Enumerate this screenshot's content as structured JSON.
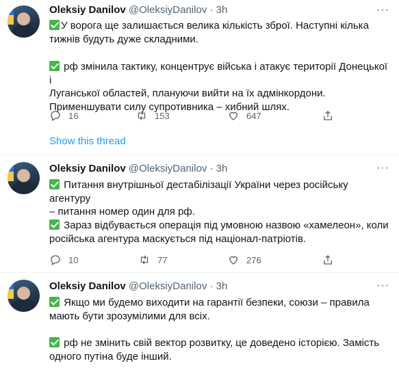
{
  "tweets": [
    {
      "author": "Oleksiy Danilov",
      "handle": "@OleksiyDanilov",
      "dot": "·",
      "time": "3h",
      "more": "···",
      "p1_lines": [
        "У ворога ще залишається велика кількість зброї. Наступні кілька",
        "тижнів будуть дуже складними."
      ],
      "p2_lines": [
        "рф змінила тактику, концентрує війська і атакує території Донецької і",
        "Луганської областей, плануючи вийти на їх адмінкордони.",
        "Применшувати силу супротивника – хибний шлях."
      ],
      "replies": "16",
      "retweets": "153",
      "likes": "647"
    },
    {
      "author": "Oleksiy Danilov",
      "handle": "@OleksiyDanilov",
      "dot": "·",
      "time": "3h",
      "more": "···",
      "p1_lines": [
        "Питання внутрішньої дестабілізації України через російську агентуру",
        "– питання номер один для рф."
      ],
      "p2_lines": [
        "Зараз відбувається операція під умовною назвою «хамелеон», коли",
        "російська агентура маскується під націонал-патріотів."
      ],
      "replies": "10",
      "retweets": "77",
      "likes": "276"
    },
    {
      "author": "Oleksiy Danilov",
      "handle": "@OleksiyDanilov",
      "dot": "·",
      "time": "3h",
      "more": "···",
      "p1_lines": [
        "Якщо ми будемо виходити на гарантії безпеки, союзи – правила",
        "мають бути зрозумілими для всіх."
      ],
      "p2_lines": [
        "рф не змінить свій вектор розвитку, це доведено історією. Замість",
        "одного путіна буде інший."
      ]
    }
  ],
  "show_thread": "Show this thread",
  "colors": {
    "accent": "#1d9bf0",
    "check": "#47b549",
    "muted": "#536471"
  }
}
